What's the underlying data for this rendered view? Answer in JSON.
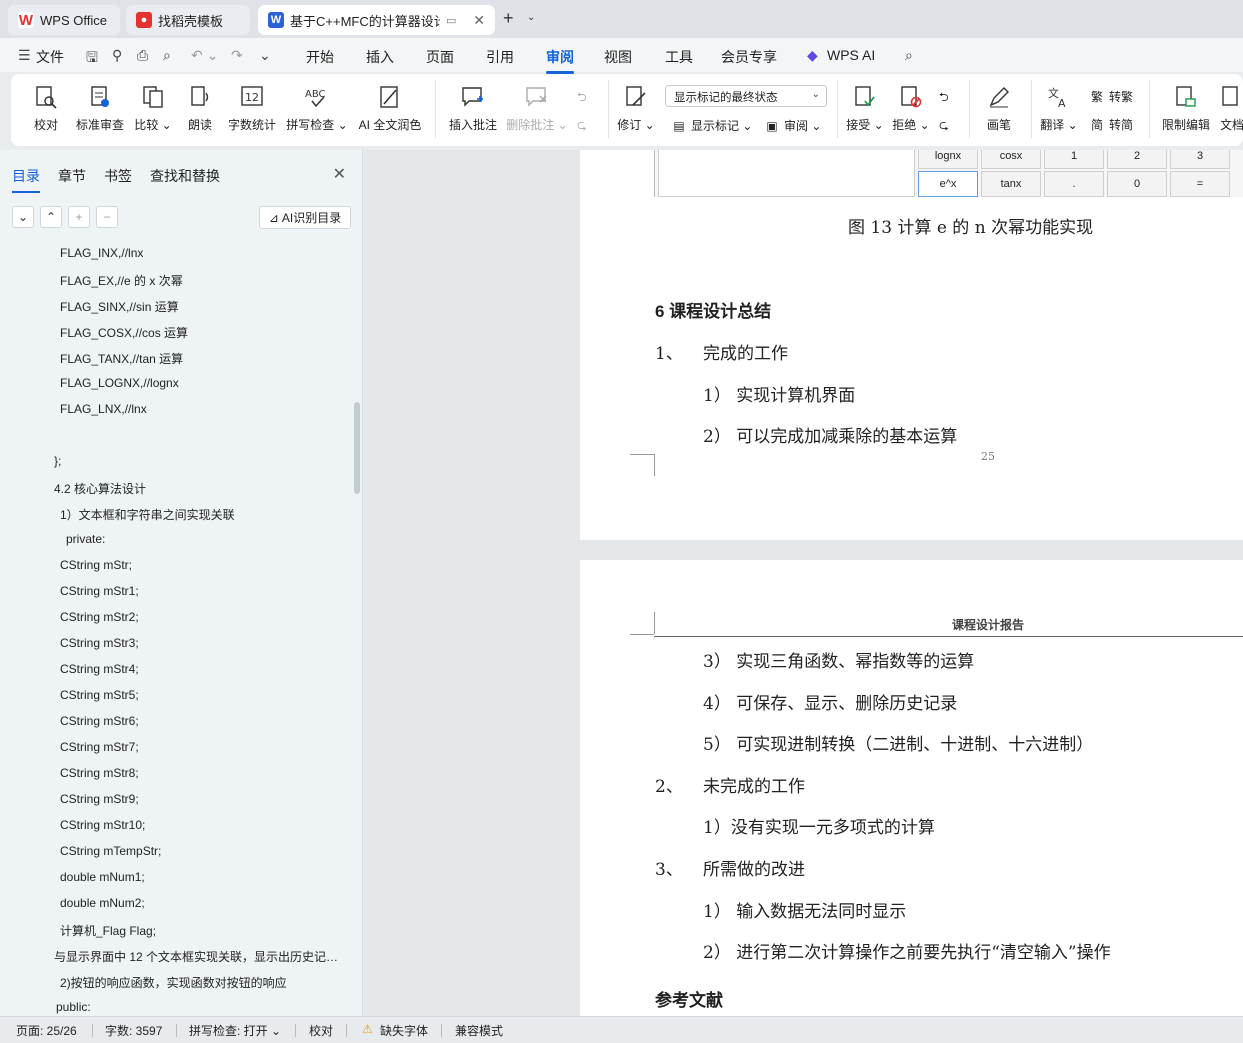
{
  "tabs": {
    "wps": "WPS Office",
    "template": "找稻壳模板",
    "doc": "基于C++MFC的计算器设计"
  },
  "menu": {
    "file": "文件",
    "items": [
      "开始",
      "插入",
      "页面",
      "引用",
      "审阅",
      "视图",
      "工具",
      "会员专享"
    ],
    "active": "审阅",
    "wps_ai": "WPS AI"
  },
  "ribbon": {
    "proofread": "校对",
    "std_review": "标准审查",
    "compare": "比较",
    "read_aloud": "朗读",
    "word_count": "字数统计",
    "spell_check": "拼写检查",
    "ai_polish": "AI 全文润色",
    "insert_comment": "插入批注",
    "delete_comment": "删除批注",
    "track_changes": "修订",
    "markup_state": "显示标记的最终状态",
    "show_markup": "显示标记",
    "review": "审阅",
    "accept": "接受",
    "reject": "拒绝",
    "pen": "画笔",
    "translate": "翻译",
    "to_traditional": "转繁",
    "to_simplified": "转简",
    "restrict_edit": "限制编辑",
    "doc_more": "文档"
  },
  "nav": {
    "tabs": [
      "目录",
      "章节",
      "书签",
      "查找和替换"
    ],
    "ai_outline": "AI识别目录",
    "items": [
      "FLAG_INX,//lnx",
      "FLAG_EX,//e 的 x 次幂",
      "FLAG_SINX,//sin 运算",
      "FLAG_COSX,//cos 运算",
      "FLAG_TANX,//tan 运算",
      "FLAG_LOGNX,//lognx",
      "FLAG_LNX,//lnx",
      "",
      "};",
      "4.2  核心算法设计",
      "1）文本框和字符串之间实现关联",
      "private:",
      "CString mStr;",
      "CString mStr1;",
      "CString mStr2;",
      "CString mStr3;",
      "CString mStr4;",
      "CString mStr5;",
      "CString mStr6;",
      "CString mStr7;",
      "CString mStr8;",
      "CString mStr9;",
      "CString mStr10;",
      "CString mTempStr;",
      "double mNum1;",
      "double mNum2;",
      "计算机_Flag Flag;",
      "与显示界面中 12 个文本框实现关联，显示出历史记录…",
      "2)按钮的响应函数，实现函数对按钮的响应",
      "public:"
    ]
  },
  "document": {
    "calc_row1": [
      "lognx",
      "cosx",
      "1",
      "2",
      "3"
    ],
    "calc_row2": [
      "e^x",
      "tanx",
      ".",
      "0",
      "="
    ],
    "fig_caption": "图 13  计算 e 的 n 次幂功能实现",
    "section_title": "6  课程设计总结",
    "item1_num": "1、",
    "item1": "完成的工作",
    "sub1": "1）  实现计算机界面",
    "sub2": "2）  可以完成加减乘除的基本运算",
    "page_num": "25",
    "header": "课程设计报告",
    "sub3": "3）  实现三角函数、幂指数等的运算",
    "sub4": "4）  可保存、显示、删除历史记录",
    "sub5": "5）  可实现进制转换（二进制、十进制、十六进制）",
    "item2_num": "2、",
    "item2": "未完成的工作",
    "sub6": "1）没有实现一元多项式的计算",
    "item3_num": "3、",
    "item3": "所需做的改进",
    "sub7": "1）  输入数据无法同时显示",
    "sub8": "2）  进行第二次计算操作之前要先执行“清空输入”操作",
    "refs": "参考文献"
  },
  "status": {
    "page": "页面: 25/26",
    "words": "字数: 3597",
    "spell": "拼写检查: 打开",
    "proof": "校对",
    "missing_font": "缺失字体",
    "compat": "兼容模式"
  },
  "colors": {
    "accent": "#1463d9",
    "wps_red": "#e5322d",
    "word_blue": "#2b62d8"
  }
}
